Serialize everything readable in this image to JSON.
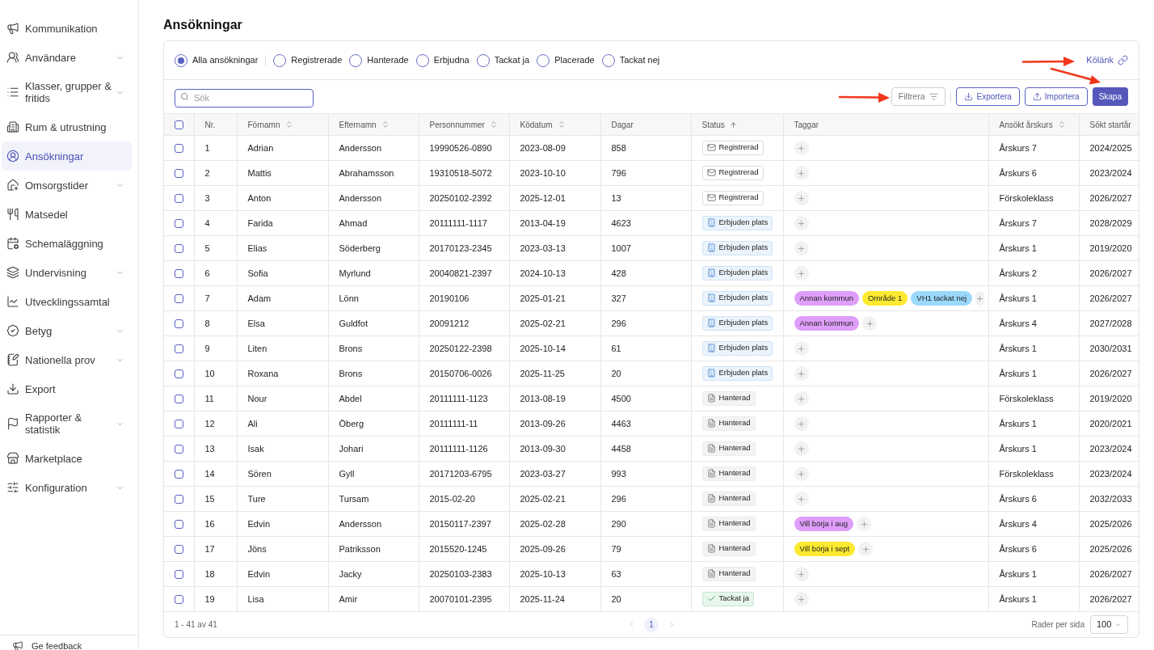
{
  "sidebar": {
    "items": [
      {
        "label": "Kommunikation",
        "expandable": false,
        "selected": false
      },
      {
        "label": "Användare",
        "expandable": true,
        "selected": false
      },
      {
        "label": "Klasser, grupper & fritids",
        "expandable": true,
        "selected": false
      },
      {
        "label": "Rum & utrustning",
        "expandable": false,
        "selected": false
      },
      {
        "label": "Ansökningar",
        "expandable": false,
        "selected": true
      },
      {
        "label": "Omsorgstider",
        "expandable": true,
        "selected": false
      },
      {
        "label": "Matsedel",
        "expandable": false,
        "selected": false
      },
      {
        "label": "Schemaläggning",
        "expandable": false,
        "selected": false
      },
      {
        "label": "Undervisning",
        "expandable": true,
        "selected": false
      },
      {
        "label": "Utvecklingssamtal",
        "expandable": false,
        "selected": false
      },
      {
        "label": "Betyg",
        "expandable": true,
        "selected": false
      },
      {
        "label": "Nationella prov",
        "expandable": true,
        "selected": false
      },
      {
        "label": "Export",
        "expandable": false,
        "selected": false
      },
      {
        "label": "Rapporter & statistik",
        "expandable": true,
        "selected": false
      },
      {
        "label": "Marketplace",
        "expandable": false,
        "selected": false
      },
      {
        "label": "Konfiguration",
        "expandable": true,
        "selected": false
      }
    ],
    "feedback": "Ge feedback"
  },
  "page": {
    "title": "Ansökningar"
  },
  "filters": {
    "options": [
      {
        "label": "Alla ansökningar",
        "selected": true
      },
      {
        "label": "Registrerade",
        "selected": false
      },
      {
        "label": "Hanterade",
        "selected": false
      },
      {
        "label": "Erbjudna",
        "selected": false
      },
      {
        "label": "Tackat ja",
        "selected": false
      },
      {
        "label": "Placerade",
        "selected": false
      },
      {
        "label": "Tackat nej",
        "selected": false
      }
    ],
    "link": "Kölänk"
  },
  "toolbar": {
    "search": {
      "placeholder": "Sök"
    },
    "buttons": [
      {
        "label": "Filtrera",
        "kind": "filter"
      },
      {
        "label": "Exportera",
        "kind": "export"
      },
      {
        "label": "Importera",
        "kind": "import"
      },
      {
        "label": "Skapa",
        "kind": "primary"
      }
    ]
  },
  "table": {
    "select_all": {
      "checked": false
    },
    "columns": [
      {
        "label": "Nr.",
        "sortable": false,
        "sorted": false
      },
      {
        "label": "Förnamn",
        "sortable": true,
        "sorted": false
      },
      {
        "label": "Efternamn",
        "sortable": true,
        "sorted": false
      },
      {
        "label": "Personnummer",
        "sortable": true,
        "sorted": false
      },
      {
        "label": "Ködatum",
        "sortable": true,
        "sorted": false
      },
      {
        "label": "Dagar",
        "sortable": false,
        "sorted": false
      },
      {
        "label": "Status",
        "sortable": true,
        "sorted": true
      },
      {
        "label": "Taggar",
        "sortable": false,
        "sorted": false
      },
      {
        "label": "Ansökt årskurs",
        "sortable": true,
        "sorted": false
      },
      {
        "label": "Sökt startår",
        "sortable": false,
        "sorted": false
      }
    ],
    "rows": [
      {
        "checked": false,
        "nr": "1",
        "first_name": "Adrian",
        "last_name": "Andersson",
        "personnummer": "19990526-0890",
        "queue_date": "2023-08-09",
        "days": "858",
        "status": {
          "label": "Registrerad",
          "kind": "registered"
        },
        "tags": [],
        "grade": "Årskurs 7",
        "start_year": "2024/2025"
      },
      {
        "checked": false,
        "nr": "2",
        "first_name": "Mattis",
        "last_name": "Abrahamsson",
        "personnummer": "19310518-5072",
        "queue_date": "2023-10-10",
        "days": "796",
        "status": {
          "label": "Registrerad",
          "kind": "registered"
        },
        "tags": [],
        "grade": "Årskurs 6",
        "start_year": "2023/2024"
      },
      {
        "checked": false,
        "nr": "3",
        "first_name": "Anton",
        "last_name": "Andersson",
        "personnummer": "20250102-2392",
        "queue_date": "2025-12-01",
        "days": "13",
        "status": {
          "label": "Registrerad",
          "kind": "registered"
        },
        "tags": [],
        "grade": "Förskoleklass",
        "start_year": "2026/2027"
      },
      {
        "checked": false,
        "nr": "4",
        "first_name": "Farida",
        "last_name": "Ahmad",
        "personnummer": "20111111-1117",
        "queue_date": "2013-04-19",
        "days": "4623",
        "status": {
          "label": "Erbjuden plats",
          "kind": "offered"
        },
        "tags": [],
        "grade": "Årskurs 7",
        "start_year": "2028/2029"
      },
      {
        "checked": false,
        "nr": "5",
        "first_name": "Elias",
        "last_name": "Söderberg",
        "personnummer": "20170123-2345",
        "queue_date": "2023-03-13",
        "days": "1007",
        "status": {
          "label": "Erbjuden plats",
          "kind": "offered"
        },
        "tags": [],
        "grade": "Årskurs 1",
        "start_year": "2019/2020"
      },
      {
        "checked": false,
        "nr": "6",
        "first_name": "Sofia",
        "last_name": "Myrlund",
        "personnummer": "20040821-2397",
        "queue_date": "2024-10-13",
        "days": "428",
        "status": {
          "label": "Erbjuden plats",
          "kind": "offered"
        },
        "tags": [],
        "grade": "Årskurs 2",
        "start_year": "2026/2027"
      },
      {
        "checked": false,
        "nr": "7",
        "first_name": "Adam",
        "last_name": "Lönn",
        "personnummer": "20190106",
        "queue_date": "2025-01-21",
        "days": "327",
        "status": {
          "label": "Erbjuden plats",
          "kind": "offered"
        },
        "tags": [
          {
            "label": "Annan kommun",
            "color": "#de9ef9"
          },
          {
            "label": "Område 1",
            "color": "#fde92f"
          },
          {
            "label": "VH1 tackat nej",
            "color": "#9ad9fb"
          }
        ],
        "grade": "Årskurs 1",
        "start_year": "2026/2027"
      },
      {
        "checked": false,
        "nr": "8",
        "first_name": "Elsa",
        "last_name": "Guldfot",
        "personnummer": "20091212",
        "queue_date": "2025-02-21",
        "days": "296",
        "status": {
          "label": "Erbjuden plats",
          "kind": "offered"
        },
        "tags": [
          {
            "label": "Annan kommun",
            "color": "#de9ef9"
          }
        ],
        "grade": "Årskurs 4",
        "start_year": "2027/2028"
      },
      {
        "checked": false,
        "nr": "9",
        "first_name": "Liten",
        "last_name": "Brons",
        "personnummer": "20250122-2398",
        "queue_date": "2025-10-14",
        "days": "61",
        "status": {
          "label": "Erbjuden plats",
          "kind": "offered"
        },
        "tags": [],
        "grade": "Årskurs 1",
        "start_year": "2030/2031"
      },
      {
        "checked": false,
        "nr": "10",
        "first_name": "Roxana",
        "last_name": "Brons",
        "personnummer": "20150706-0026",
        "queue_date": "2025-11-25",
        "days": "20",
        "status": {
          "label": "Erbjuden plats",
          "kind": "offered"
        },
        "tags": [],
        "grade": "Årskurs 1",
        "start_year": "2026/2027"
      },
      {
        "checked": false,
        "nr": "11",
        "first_name": "Nour",
        "last_name": "Abdel",
        "personnummer": "20111111-1123",
        "queue_date": "2013-08-19",
        "days": "4500",
        "status": {
          "label": "Hanterad",
          "kind": "handled"
        },
        "tags": [],
        "grade": "Förskoleklass",
        "start_year": "2019/2020"
      },
      {
        "checked": false,
        "nr": "12",
        "first_name": "Ali",
        "last_name": "Öberg",
        "personnummer": "20111111-11",
        "queue_date": "2013-09-26",
        "days": "4463",
        "status": {
          "label": "Hanterad",
          "kind": "handled"
        },
        "tags": [],
        "grade": "Årskurs 1",
        "start_year": "2020/2021"
      },
      {
        "checked": false,
        "nr": "13",
        "first_name": "Isak",
        "last_name": "Johari",
        "personnummer": "20111111-1126",
        "queue_date": "2013-09-30",
        "days": "4458",
        "status": {
          "label": "Hanterad",
          "kind": "handled"
        },
        "tags": [],
        "grade": "Årskurs 1",
        "start_year": "2023/2024"
      },
      {
        "checked": false,
        "nr": "14",
        "first_name": "Sören",
        "last_name": "Gyll",
        "personnummer": "20171203-6795",
        "queue_date": "2023-03-27",
        "days": "993",
        "status": {
          "label": "Hanterad",
          "kind": "handled"
        },
        "tags": [],
        "grade": "Förskoleklass",
        "start_year": "2023/2024"
      },
      {
        "checked": false,
        "nr": "15",
        "first_name": "Ture",
        "last_name": "Tursam",
        "personnummer": "2015-02-20",
        "queue_date": "2025-02-21",
        "days": "296",
        "status": {
          "label": "Hanterad",
          "kind": "handled"
        },
        "tags": [],
        "grade": "Årskurs 6",
        "start_year": "2032/2033"
      },
      {
        "checked": false,
        "nr": "16",
        "first_name": "Edvin",
        "last_name": "Andersson",
        "personnummer": "20150117-2397",
        "queue_date": "2025-02-28",
        "days": "290",
        "status": {
          "label": "Hanterad",
          "kind": "handled"
        },
        "tags": [
          {
            "label": "Vill börja i aug",
            "color": "#de9ef9"
          }
        ],
        "grade": "Årskurs 4",
        "start_year": "2025/2026"
      },
      {
        "checked": false,
        "nr": "17",
        "first_name": "Jöns",
        "last_name": "Patriksson",
        "personnummer": "2015520-1245",
        "queue_date": "2025-09-26",
        "days": "79",
        "status": {
          "label": "Hanterad",
          "kind": "handled"
        },
        "tags": [
          {
            "label": "Vill börja i sept",
            "color": "#fde92f"
          }
        ],
        "grade": "Årskurs 6",
        "start_year": "2025/2026"
      },
      {
        "checked": false,
        "nr": "18",
        "first_name": "Edvin",
        "last_name": "Jacky",
        "personnummer": "20250103-2383",
        "queue_date": "2025-10-13",
        "days": "63",
        "status": {
          "label": "Hanterad",
          "kind": "handled"
        },
        "tags": [],
        "grade": "Årskurs 1",
        "start_year": "2026/2027"
      },
      {
        "checked": false,
        "nr": "19",
        "first_name": "Lisa",
        "last_name": "Amir",
        "personnummer": "20070101-2395",
        "queue_date": "2025-11-24",
        "days": "20",
        "status": {
          "label": "Tackat ja",
          "kind": "accepted"
        },
        "tags": [],
        "grade": "Årskurs 1",
        "start_year": "2026/2027"
      }
    ]
  },
  "footer": {
    "range": "1 - 41 av 41",
    "pages": [
      {
        "label": "1",
        "selected": true
      }
    ],
    "rows_per_page_label": "Rader per sida",
    "rows_per_page": "100"
  }
}
